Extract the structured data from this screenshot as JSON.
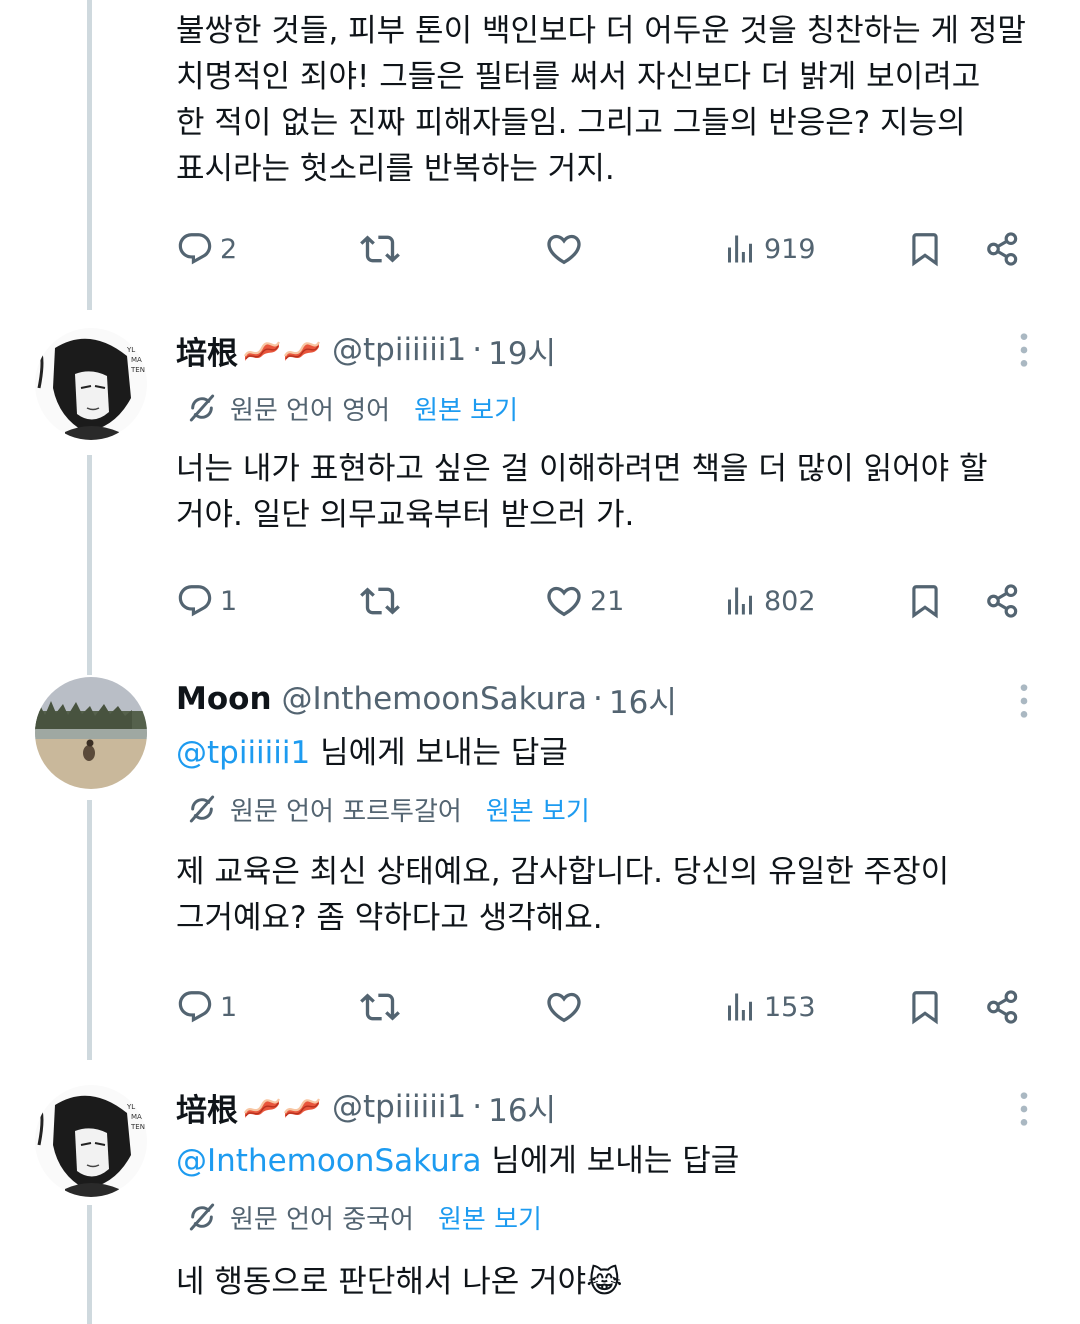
{
  "top_post": {
    "text_lines": [
      "불쌍한 것들, 피부 톤이 백인보다 더 어두운 것을 칭찬하는 게 정말",
      "치명적인 죄야! 그들은 필터를 써서 자신보다 더 밝게 보이려고",
      "한 적이 없는 진짜 피해자들임. 그리고 그들의 반응은? 지능의",
      "표시라는 헛소리를 반복하는 거지."
    ],
    "actions": {
      "replies": "2",
      "retweets": "",
      "likes": "",
      "views": "919"
    }
  },
  "posts": [
    {
      "name": "培根",
      "handle": "@tpiiiiii1",
      "time": "19시",
      "translation": {
        "label": "원문 언어 영어",
        "show": "원본 보기"
      },
      "text_lines": [
        "너는 내가 표현하고 싶은 걸 이해하려면 책을 더 많이 읽어야 할",
        "거야. 일단 의무교육부터 받으러 가."
      ],
      "actions": {
        "replies": "1",
        "retweets": "",
        "likes": "21",
        "views": "802"
      }
    },
    {
      "name": "Moon",
      "handle": "@InthemoonSakura",
      "time": "16시",
      "reply_to": {
        "mention": "@tpiiiiii1",
        "suffix": " 님에게 보내는 답글"
      },
      "translation": {
        "label": "원문 언어 포르투갈어",
        "show": "원본 보기"
      },
      "text_lines": [
        "제 교육은 최신 상태예요, 감사합니다. 당신의 유일한 주장이",
        "그거예요? 좀 약하다고 생각해요."
      ],
      "actions": {
        "replies": "1",
        "retweets": "",
        "likes": "",
        "views": "153"
      }
    },
    {
      "name": "培根",
      "handle": "@tpiiiiii1",
      "time": "16시",
      "reply_to": {
        "mention": "@InthemoonSakura",
        "suffix": " 님에게 보내는 답글"
      },
      "translation": {
        "label": "원문 언어 중국어",
        "show": "원본 보기"
      },
      "text_lines": [
        "네 행동으로 판단해서 나온 거야"
      ],
      "emoji": "😹"
    }
  ],
  "colors": {
    "accent": "#1d9bf0",
    "muted": "#536471",
    "text": "#0f1419",
    "line": "#cfd9de"
  },
  "icons": [
    "reply-icon",
    "retweet-icon",
    "like-icon",
    "views-icon",
    "bookmark-icon",
    "share-icon",
    "more-icon",
    "translate-icon",
    "bacon-emoji"
  ]
}
